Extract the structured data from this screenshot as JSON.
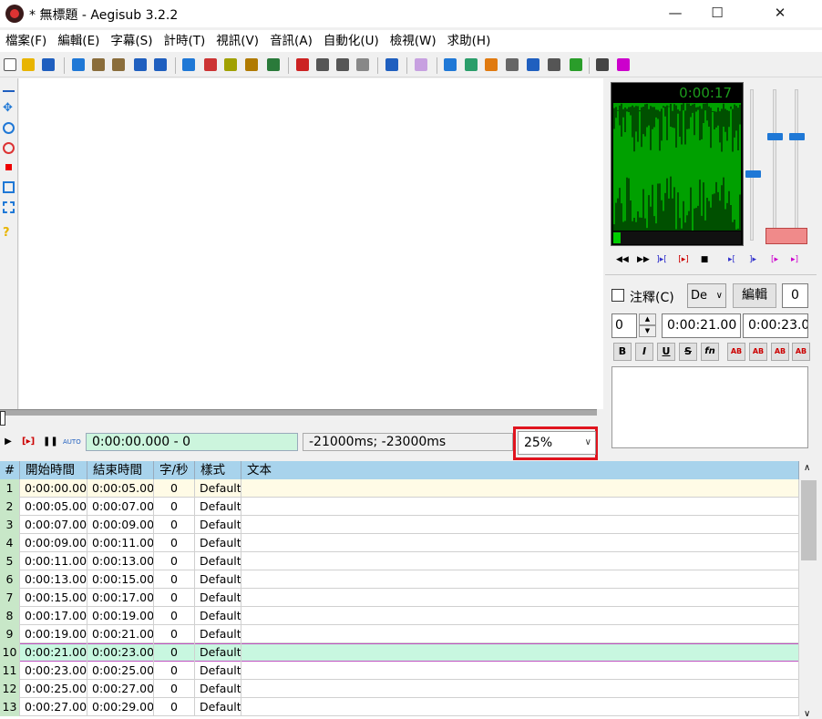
{
  "window": {
    "title": "* 無標題 - Aegisub 3.2.2"
  },
  "menu": [
    "檔案(F)",
    "編輯(E)",
    "字幕(S)",
    "計時(T)",
    "視訊(V)",
    "音訊(A)",
    "自動化(U)",
    "檢視(W)",
    "求助(H)"
  ],
  "video": {
    "time_display": "0:00:00.000 - 0",
    "offset_display": "-21000ms; -23000ms",
    "zoom": "25%"
  },
  "audio": {
    "time": "0:00:17"
  },
  "edit": {
    "comment_label": "注釋(C)",
    "style_value": "De",
    "edit_label": "編輯",
    "margin_value": "0",
    "layer_value": "0",
    "start_time": "0:00:21.00",
    "end_time": "0:00:23.0"
  },
  "grid": {
    "headers": [
      "#",
      "開始時間",
      "結束時間",
      "字/秒",
      "樣式",
      "文本"
    ],
    "rows": [
      {
        "num": "1",
        "start": "0:00:00.00",
        "end": "0:00:05.00",
        "cps": "0",
        "style": "Default",
        "text": ""
      },
      {
        "num": "2",
        "start": "0:00:05.00",
        "end": "0:00:07.00",
        "cps": "0",
        "style": "Default",
        "text": ""
      },
      {
        "num": "3",
        "start": "0:00:07.00",
        "end": "0:00:09.00",
        "cps": "0",
        "style": "Default",
        "text": ""
      },
      {
        "num": "4",
        "start": "0:00:09.00",
        "end": "0:00:11.00",
        "cps": "0",
        "style": "Default",
        "text": ""
      },
      {
        "num": "5",
        "start": "0:00:11.00",
        "end": "0:00:13.00",
        "cps": "0",
        "style": "Default",
        "text": ""
      },
      {
        "num": "6",
        "start": "0:00:13.00",
        "end": "0:00:15.00",
        "cps": "0",
        "style": "Default",
        "text": ""
      },
      {
        "num": "7",
        "start": "0:00:15.00",
        "end": "0:00:17.00",
        "cps": "0",
        "style": "Default",
        "text": ""
      },
      {
        "num": "8",
        "start": "0:00:17.00",
        "end": "0:00:19.00",
        "cps": "0",
        "style": "Default",
        "text": ""
      },
      {
        "num": "9",
        "start": "0:00:19.00",
        "end": "0:00:21.00",
        "cps": "0",
        "style": "Default",
        "text": ""
      },
      {
        "num": "10",
        "start": "0:00:21.00",
        "end": "0:00:23.00",
        "cps": "0",
        "style": "Default",
        "text": ""
      },
      {
        "num": "11",
        "start": "0:00:23.00",
        "end": "0:00:25.00",
        "cps": "0",
        "style": "Default",
        "text": ""
      },
      {
        "num": "12",
        "start": "0:00:25.00",
        "end": "0:00:27.00",
        "cps": "0",
        "style": "Default",
        "text": ""
      },
      {
        "num": "13",
        "start": "0:00:27.00",
        "end": "0:00:29.00",
        "cps": "0",
        "style": "Default",
        "text": ""
      }
    ]
  },
  "colors": {
    "header_bg": "#a8d3ec",
    "row_first_bg": "#fffbe6",
    "row_selected_bg": "#c8f7e0",
    "number_col_bg": "#c8e7c8",
    "waveform": "#00a000",
    "highlight_box": "#e0141e"
  }
}
